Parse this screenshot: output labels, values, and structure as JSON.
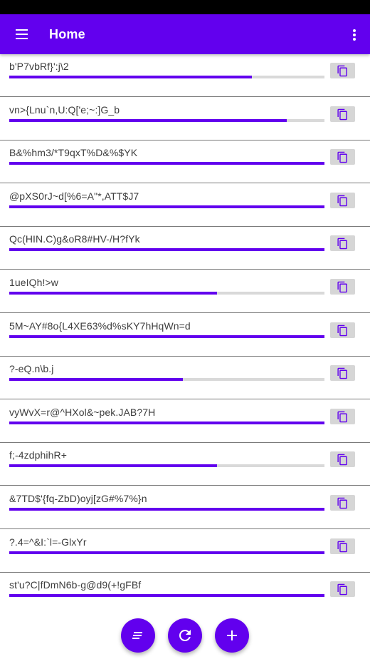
{
  "app_bar": {
    "title": "Home",
    "menu_icon": "hamburger-menu-icon",
    "more_icon": "more-vertical-icon",
    "color": "#6200ee"
  },
  "passwords": [
    {
      "text": "b'P7vbRf}':j\\2",
      "strength": 0.77
    },
    {
      "text": "vn>{Lnu`n,U:Q['e;~:]G_b",
      "strength": 0.88
    },
    {
      "text": "B&%hm3/*T9qxT%D&%$YK",
      "strength": 1.0
    },
    {
      "text": "@pXS0rJ~d[%6=A\"*,ATT$J7",
      "strength": 1.0
    },
    {
      "text": "Qc(HIN.C)g&oR8#HV-/H?fYk",
      "strength": 1.0
    },
    {
      "text": "1ueIQh!>w",
      "strength": 0.66
    },
    {
      "text": "5M~AY#8o{L4XE63%d%sKY7hHqWn=d",
      "strength": 1.0
    },
    {
      "text": "?-eQ.n\\b.j",
      "strength": 0.55
    },
    {
      "text": "vyWvX=r@^HXol&~pek.JAB?7H",
      "strength": 1.0
    },
    {
      "text": "f;-4zdphihR+",
      "strength": 0.66
    },
    {
      "text": "&7TD$'{fq-ZbD)oyj[zG#%7%}n",
      "strength": 1.0
    },
    {
      "text": "?.4=^&I:`l=-GlxYr",
      "strength": 1.0
    },
    {
      "text": "st'u?C|fDmN6b-g@d9(+!gFBf",
      "strength": 1.0
    }
  ],
  "copy_icon": "copy-icon",
  "fabs": [
    {
      "icon": "sort-icon"
    },
    {
      "icon": "refresh-icon"
    },
    {
      "icon": "add-icon"
    }
  ]
}
